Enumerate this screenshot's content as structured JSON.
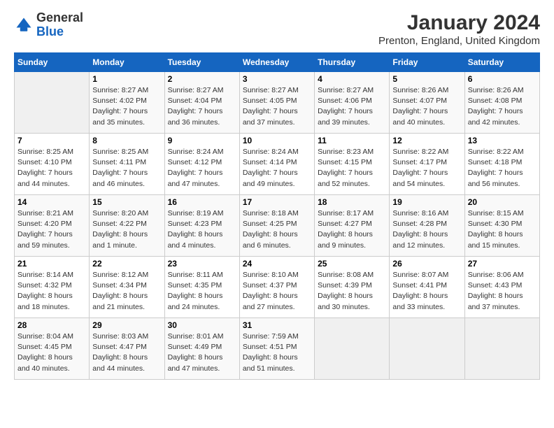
{
  "header": {
    "logo_line1": "General",
    "logo_line2": "Blue",
    "title": "January 2024",
    "subtitle": "Prenton, England, United Kingdom"
  },
  "weekdays": [
    "Sunday",
    "Monday",
    "Tuesday",
    "Wednesday",
    "Thursday",
    "Friday",
    "Saturday"
  ],
  "weeks": [
    [
      {
        "day": "",
        "info": ""
      },
      {
        "day": "1",
        "info": "Sunrise: 8:27 AM\nSunset: 4:02 PM\nDaylight: 7 hours\nand 35 minutes."
      },
      {
        "day": "2",
        "info": "Sunrise: 8:27 AM\nSunset: 4:04 PM\nDaylight: 7 hours\nand 36 minutes."
      },
      {
        "day": "3",
        "info": "Sunrise: 8:27 AM\nSunset: 4:05 PM\nDaylight: 7 hours\nand 37 minutes."
      },
      {
        "day": "4",
        "info": "Sunrise: 8:27 AM\nSunset: 4:06 PM\nDaylight: 7 hours\nand 39 minutes."
      },
      {
        "day": "5",
        "info": "Sunrise: 8:26 AM\nSunset: 4:07 PM\nDaylight: 7 hours\nand 40 minutes."
      },
      {
        "day": "6",
        "info": "Sunrise: 8:26 AM\nSunset: 4:08 PM\nDaylight: 7 hours\nand 42 minutes."
      }
    ],
    [
      {
        "day": "7",
        "info": "Sunrise: 8:25 AM\nSunset: 4:10 PM\nDaylight: 7 hours\nand 44 minutes."
      },
      {
        "day": "8",
        "info": "Sunrise: 8:25 AM\nSunset: 4:11 PM\nDaylight: 7 hours\nand 46 minutes."
      },
      {
        "day": "9",
        "info": "Sunrise: 8:24 AM\nSunset: 4:12 PM\nDaylight: 7 hours\nand 47 minutes."
      },
      {
        "day": "10",
        "info": "Sunrise: 8:24 AM\nSunset: 4:14 PM\nDaylight: 7 hours\nand 49 minutes."
      },
      {
        "day": "11",
        "info": "Sunrise: 8:23 AM\nSunset: 4:15 PM\nDaylight: 7 hours\nand 52 minutes."
      },
      {
        "day": "12",
        "info": "Sunrise: 8:22 AM\nSunset: 4:17 PM\nDaylight: 7 hours\nand 54 minutes."
      },
      {
        "day": "13",
        "info": "Sunrise: 8:22 AM\nSunset: 4:18 PM\nDaylight: 7 hours\nand 56 minutes."
      }
    ],
    [
      {
        "day": "14",
        "info": "Sunrise: 8:21 AM\nSunset: 4:20 PM\nDaylight: 7 hours\nand 59 minutes."
      },
      {
        "day": "15",
        "info": "Sunrise: 8:20 AM\nSunset: 4:22 PM\nDaylight: 8 hours\nand 1 minute."
      },
      {
        "day": "16",
        "info": "Sunrise: 8:19 AM\nSunset: 4:23 PM\nDaylight: 8 hours\nand 4 minutes."
      },
      {
        "day": "17",
        "info": "Sunrise: 8:18 AM\nSunset: 4:25 PM\nDaylight: 8 hours\nand 6 minutes."
      },
      {
        "day": "18",
        "info": "Sunrise: 8:17 AM\nSunset: 4:27 PM\nDaylight: 8 hours\nand 9 minutes."
      },
      {
        "day": "19",
        "info": "Sunrise: 8:16 AM\nSunset: 4:28 PM\nDaylight: 8 hours\nand 12 minutes."
      },
      {
        "day": "20",
        "info": "Sunrise: 8:15 AM\nSunset: 4:30 PM\nDaylight: 8 hours\nand 15 minutes."
      }
    ],
    [
      {
        "day": "21",
        "info": "Sunrise: 8:14 AM\nSunset: 4:32 PM\nDaylight: 8 hours\nand 18 minutes."
      },
      {
        "day": "22",
        "info": "Sunrise: 8:12 AM\nSunset: 4:34 PM\nDaylight: 8 hours\nand 21 minutes."
      },
      {
        "day": "23",
        "info": "Sunrise: 8:11 AM\nSunset: 4:35 PM\nDaylight: 8 hours\nand 24 minutes."
      },
      {
        "day": "24",
        "info": "Sunrise: 8:10 AM\nSunset: 4:37 PM\nDaylight: 8 hours\nand 27 minutes."
      },
      {
        "day": "25",
        "info": "Sunrise: 8:08 AM\nSunset: 4:39 PM\nDaylight: 8 hours\nand 30 minutes."
      },
      {
        "day": "26",
        "info": "Sunrise: 8:07 AM\nSunset: 4:41 PM\nDaylight: 8 hours\nand 33 minutes."
      },
      {
        "day": "27",
        "info": "Sunrise: 8:06 AM\nSunset: 4:43 PM\nDaylight: 8 hours\nand 37 minutes."
      }
    ],
    [
      {
        "day": "28",
        "info": "Sunrise: 8:04 AM\nSunset: 4:45 PM\nDaylight: 8 hours\nand 40 minutes."
      },
      {
        "day": "29",
        "info": "Sunrise: 8:03 AM\nSunset: 4:47 PM\nDaylight: 8 hours\nand 44 minutes."
      },
      {
        "day": "30",
        "info": "Sunrise: 8:01 AM\nSunset: 4:49 PM\nDaylight: 8 hours\nand 47 minutes."
      },
      {
        "day": "31",
        "info": "Sunrise: 7:59 AM\nSunset: 4:51 PM\nDaylight: 8 hours\nand 51 minutes."
      },
      {
        "day": "",
        "info": ""
      },
      {
        "day": "",
        "info": ""
      },
      {
        "day": "",
        "info": ""
      }
    ]
  ]
}
